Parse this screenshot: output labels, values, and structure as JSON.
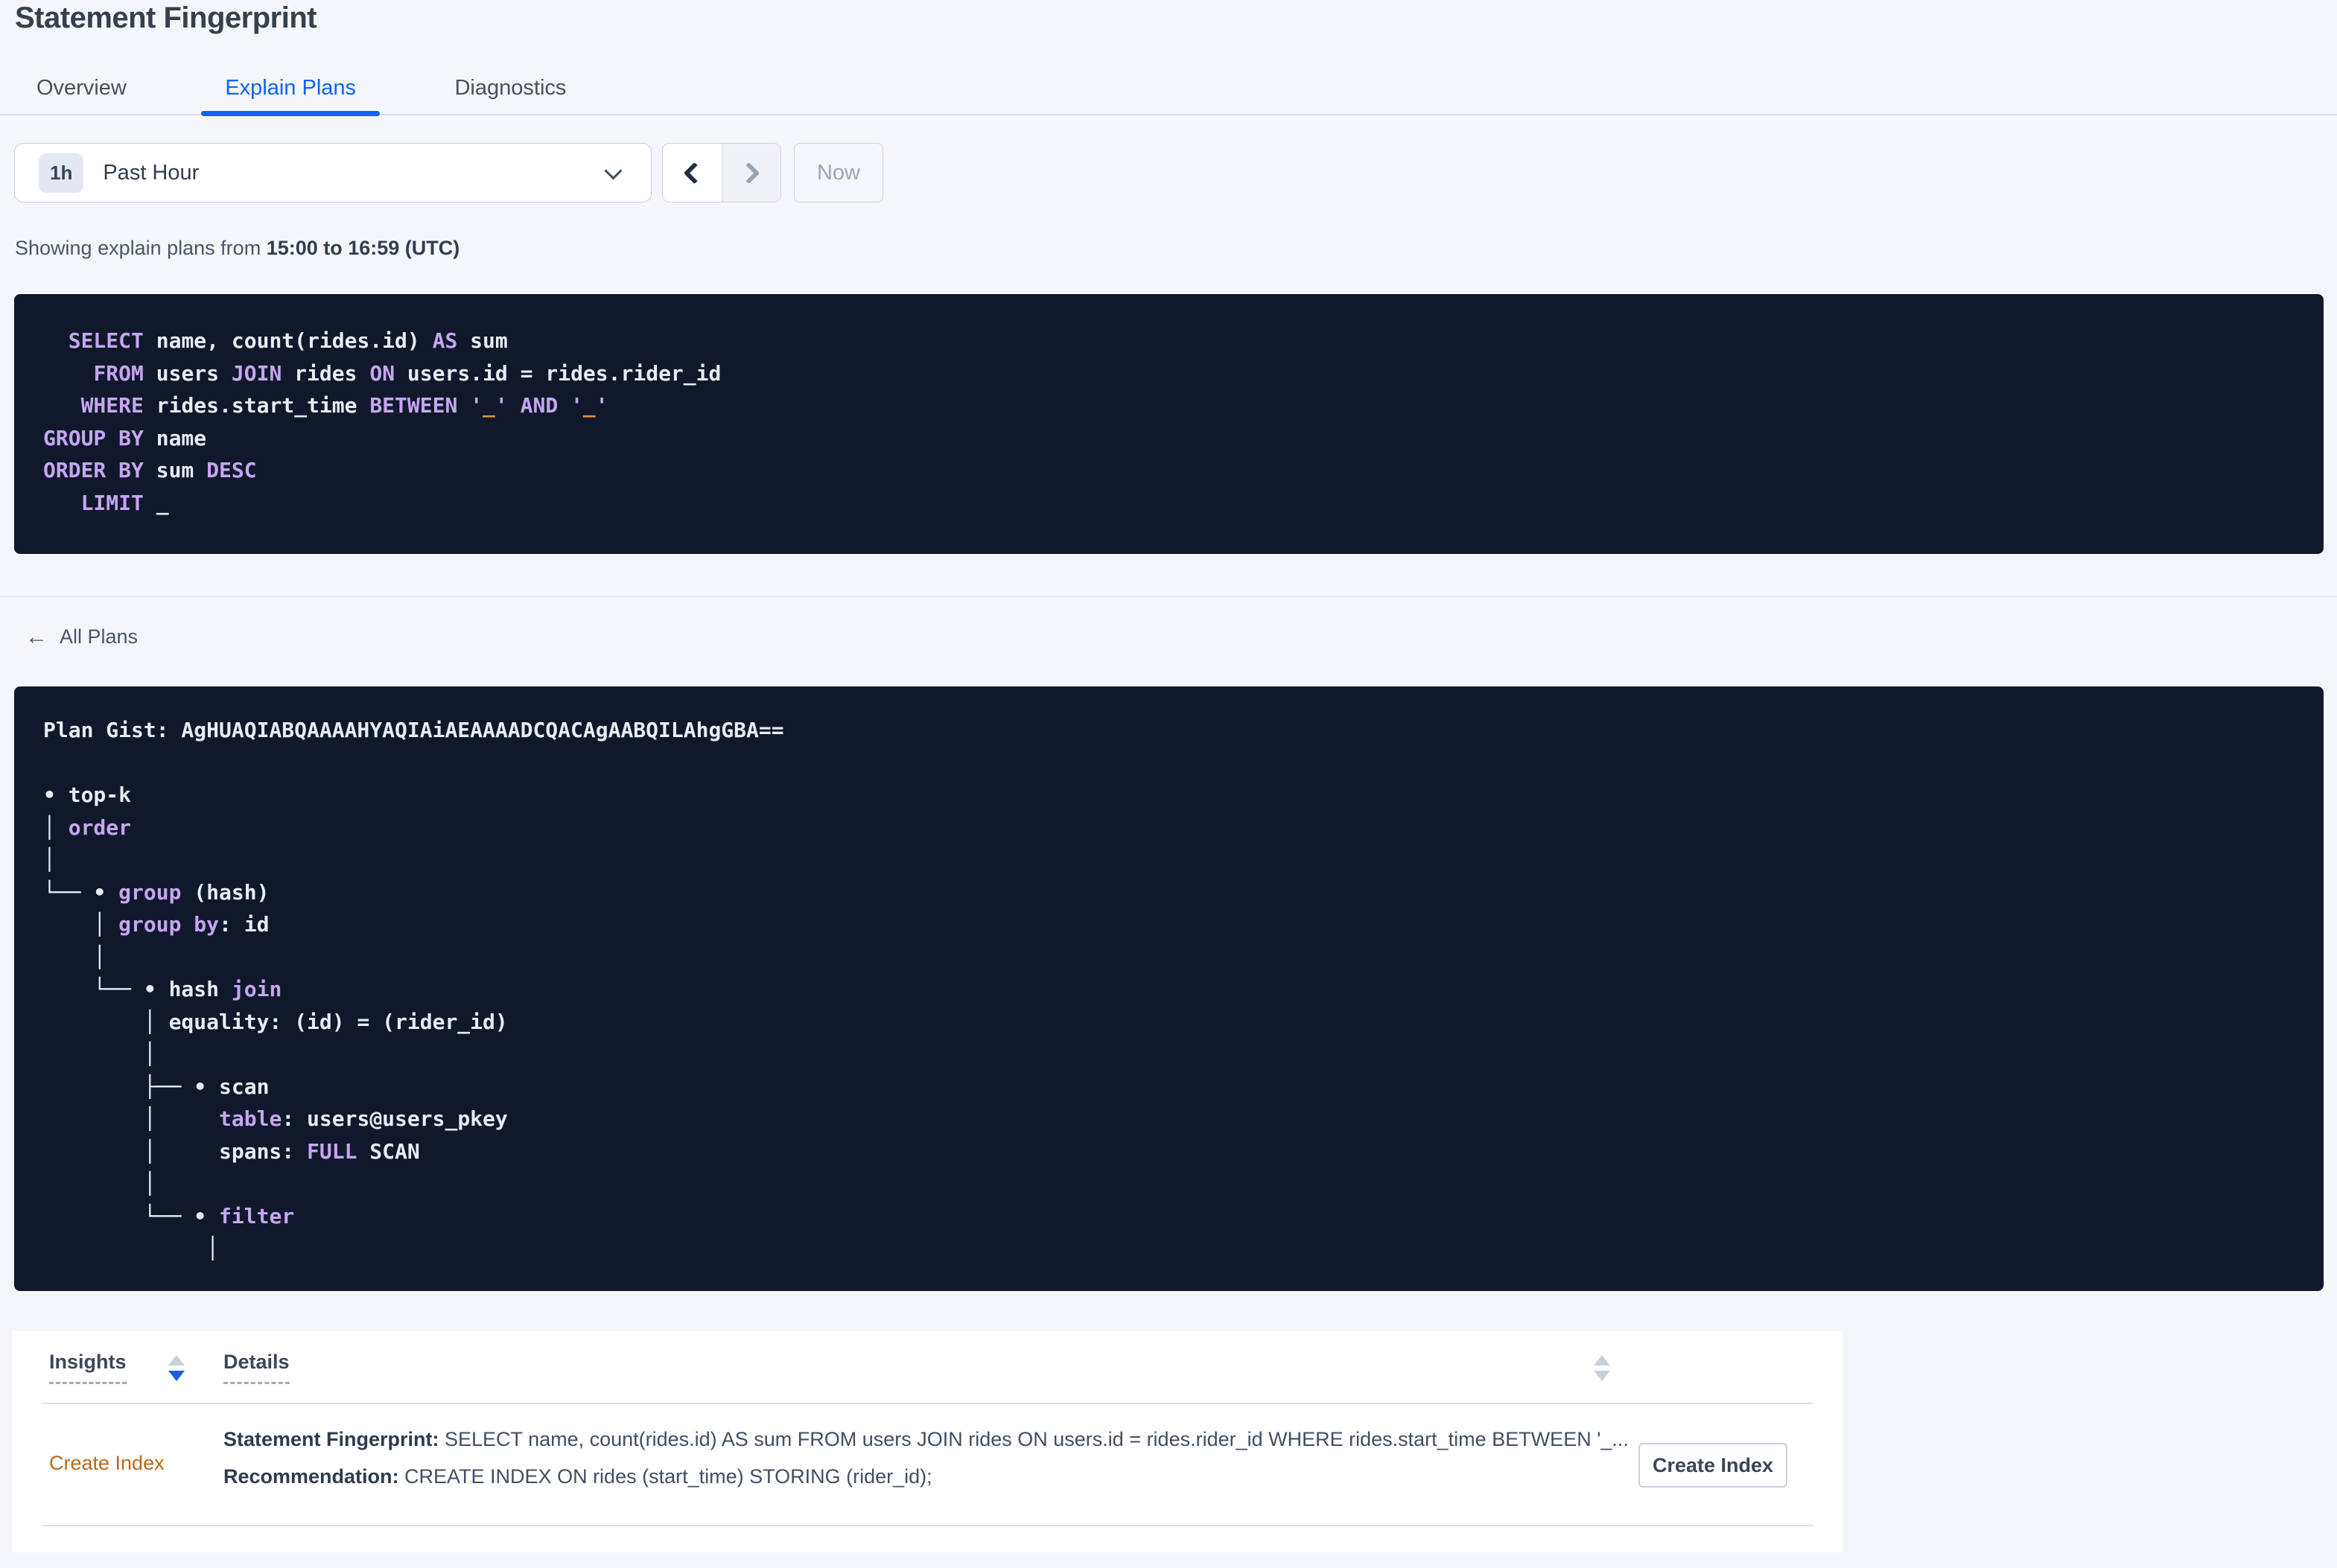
{
  "header": {
    "title": "Statement Fingerprint"
  },
  "tabs": [
    {
      "label": "Overview",
      "active": false
    },
    {
      "label": "Explain Plans",
      "active": true
    },
    {
      "label": "Diagnostics",
      "active": false
    }
  ],
  "time_picker": {
    "badge": "1h",
    "label": "Past Hour"
  },
  "time_nav": {
    "now_label": "Now"
  },
  "showing": {
    "prefix": "Showing explain plans from ",
    "range": "15:00 to 16:59 (UTC)"
  },
  "sql": {
    "lines": [
      [
        [
          "t",
          "  "
        ],
        [
          "k",
          "SELECT"
        ],
        [
          "t",
          " name, count(rides.id) "
        ],
        [
          "k",
          "AS"
        ],
        [
          "t",
          " sum"
        ]
      ],
      [
        [
          "t",
          "    "
        ],
        [
          "k",
          "FROM"
        ],
        [
          "t",
          " users "
        ],
        [
          "k",
          "JOIN"
        ],
        [
          "t",
          " rides "
        ],
        [
          "k",
          "ON"
        ],
        [
          "t",
          " users.id = rides.rider_id"
        ]
      ],
      [
        [
          "t",
          "   "
        ],
        [
          "k",
          "WHERE"
        ],
        [
          "t",
          " rides.start_time "
        ],
        [
          "k",
          "BETWEEN"
        ],
        [
          "t",
          " "
        ],
        [
          "k",
          "'"
        ],
        [
          "o",
          "_"
        ],
        [
          "k",
          "'"
        ],
        [
          "t",
          " "
        ],
        [
          "k",
          "AND"
        ],
        [
          "t",
          " "
        ],
        [
          "k",
          "'"
        ],
        [
          "o",
          "_"
        ],
        [
          "k",
          "'"
        ]
      ],
      [
        [
          "k",
          "GROUP BY"
        ],
        [
          "t",
          " name"
        ]
      ],
      [
        [
          "k",
          "ORDER BY"
        ],
        [
          "t",
          " sum "
        ],
        [
          "k",
          "DESC"
        ]
      ],
      [
        [
          "t",
          "   "
        ],
        [
          "k",
          "LIMIT"
        ],
        [
          "t",
          " _"
        ]
      ]
    ]
  },
  "all_plans": {
    "icon": "←",
    "label": "All Plans"
  },
  "gist": {
    "header": "Plan Gist: AgHUAQIABQAAAAHYAQIAiAEAAAADCQACAgAABQILAhgGBA==",
    "lines": [
      [
        [
          "t",
          "• top-k"
        ]
      ],
      [
        [
          "t",
          "│ "
        ],
        [
          "k",
          "order"
        ]
      ],
      [
        [
          "t",
          "│"
        ]
      ],
      [
        [
          "t",
          "└── • "
        ],
        [
          "k",
          "group"
        ],
        [
          "t",
          " (hash)"
        ]
      ],
      [
        [
          "t",
          "    │ "
        ],
        [
          "k",
          "group by"
        ],
        [
          "t",
          ": id"
        ]
      ],
      [
        [
          "t",
          "    │"
        ]
      ],
      [
        [
          "t",
          "    └── • hash "
        ],
        [
          "k",
          "join"
        ]
      ],
      [
        [
          "t",
          "        │ equality: (id) = (rider_id)"
        ]
      ],
      [
        [
          "t",
          "        │"
        ]
      ],
      [
        [
          "t",
          "        ├── • scan"
        ]
      ],
      [
        [
          "t",
          "        │     "
        ],
        [
          "k",
          "table"
        ],
        [
          "t",
          ": users@users_pkey"
        ]
      ],
      [
        [
          "t",
          "        │     spans: "
        ],
        [
          "k",
          "FULL"
        ],
        [
          "t",
          " SCAN"
        ]
      ],
      [
        [
          "t",
          "        │"
        ]
      ],
      [
        [
          "t",
          "        └── • "
        ],
        [
          "k",
          "filter"
        ]
      ],
      [
        [
          "t",
          "             │"
        ]
      ]
    ]
  },
  "table": {
    "headers": [
      {
        "label": "Insights",
        "sort": "desc"
      },
      {
        "label": "Details",
        "sort": "none"
      }
    ],
    "row": {
      "insight": "Create Index",
      "fingerprint_label": "Statement Fingerprint:",
      "fingerprint_text": " SELECT name, count(rides.id) AS sum FROM users JOIN rides ON users.id = rides.rider_id WHERE rides.start_time BETWEEN '_...",
      "recommendation_label": "Recommendation:",
      "recommendation_text": " CREATE INDEX ON rides (start_time) STORING (rider_id);",
      "button_label": "Create Index"
    }
  },
  "colors": {
    "accent_blue": "#0e63f6",
    "code_background": "#11182b",
    "code_keyword_purple": "#c5a6f1",
    "code_literal_orange": "#e0923f",
    "insight_link_orange": "#b96a18",
    "page_background": "#f4f6fa"
  }
}
